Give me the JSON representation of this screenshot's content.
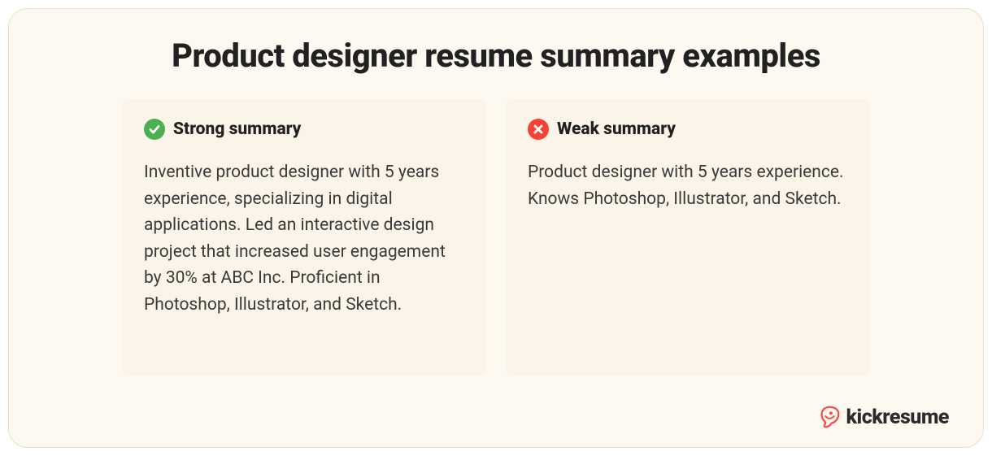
{
  "title": "Product designer resume summary examples",
  "strong": {
    "label": "Strong summary",
    "body": "Inventive product designer with 5 years experience, specializing in digital applications. Led an interactive design project that increased user engagement by 30% at ABC Inc. Proficient in Photoshop, Illustrator, and Sketch."
  },
  "weak": {
    "label": "Weak summary",
    "body": "Product designer with 5 years experience. Knows Photoshop, Illustrator, and Sketch."
  },
  "brand": {
    "name": "kickresume"
  },
  "colors": {
    "check": "#4CAF50",
    "cross": "#F44336",
    "brand": "#F0544F"
  }
}
